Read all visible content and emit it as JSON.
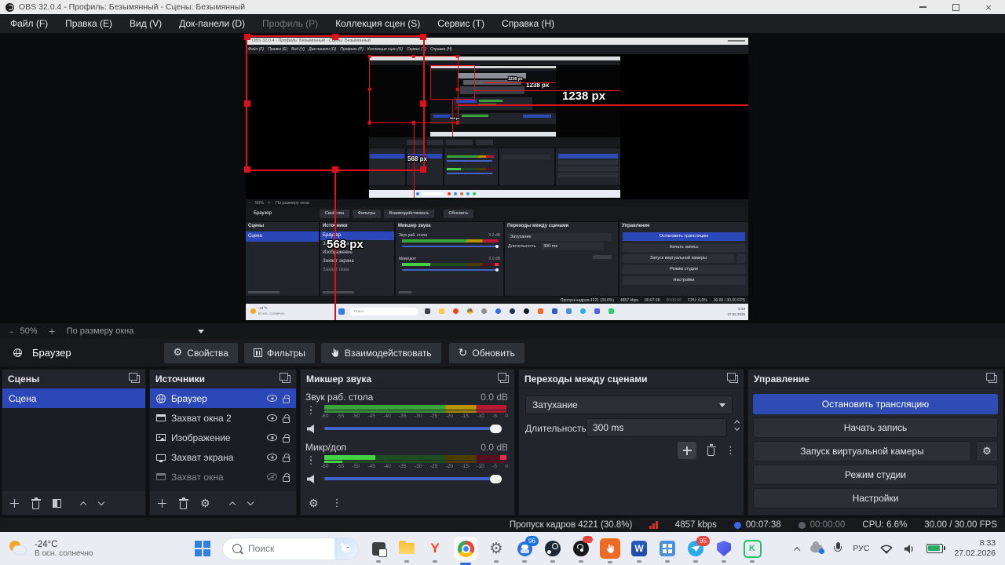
{
  "window": {
    "title": "OBS 32.0.4 - Профиль: Безымянный - Сцены: Безымянный"
  },
  "menu": {
    "items": [
      "Файл (F)",
      "Правка (E)",
      "Вид (V)",
      "Док-панели (D)",
      "Профиль (P)",
      "Коллекция сцен (S)",
      "Сервис (T)",
      "Справка (H)"
    ]
  },
  "preview": {
    "zoom": "50%",
    "fit": "По размеру окна",
    "overlay": {
      "width_label": "1238 px",
      "height_label": "568 px"
    }
  },
  "source_toolbar": {
    "source": "Браузер",
    "properties": "Свойства",
    "filters": "Фильтры",
    "interact": "Взаимодействовать",
    "refresh": "Обновить"
  },
  "scenes": {
    "title": "Сцены",
    "items": [
      "Сцена"
    ]
  },
  "sources": {
    "title": "Источники",
    "items": [
      {
        "label": "Браузер",
        "icon": "globe"
      },
      {
        "label": "Захват окна 2",
        "icon": "window"
      },
      {
        "label": "Изображение",
        "icon": "image"
      },
      {
        "label": "Захват экрана",
        "icon": "display"
      },
      {
        "label": "Захват окна",
        "icon": "window"
      }
    ]
  },
  "mixer": {
    "title": "Микшер звука",
    "channels": [
      {
        "name": "Звук раб. стола",
        "level": "0.0 dB"
      },
      {
        "name": "Микр/доп",
        "level": "0.0 dB"
      }
    ],
    "scale": [
      "-60",
      "-55",
      "-50",
      "-45",
      "-40",
      "-35",
      "-30",
      "-25",
      "-20",
      "-15",
      "-10",
      "-5",
      "0"
    ]
  },
  "transitions": {
    "title": "Переходы между сценами",
    "current": "Затухание",
    "duration_label": "Длительность",
    "duration": "300 ms"
  },
  "controls": {
    "title": "Управление",
    "stop_stream": "Остановить трансляцию",
    "start_record": "Начать запись",
    "virtual_cam": "Запуск виртуальной камеры",
    "studio_mode": "Режим студии",
    "settings": "Настройки"
  },
  "status": {
    "dropped": "Пропуск кадров 4221 (30.8%)",
    "bitrate": "4857 kbps",
    "stream_time": "00:07:38",
    "record_time": "00:00:00",
    "cpu": "CPU: 6.6%",
    "fps": "30.00 / 30.00 FPS"
  },
  "taskbar": {
    "temp": "-24°C",
    "weather": "В осн. солнечно",
    "search": "Поиск",
    "badge_chat": "96",
    "badge_telegram": "95",
    "lang": "РУС",
    "time": "8:33",
    "date": "27.02.2026"
  },
  "icons": {
    "gear": "⚙",
    "dots": "⋮",
    "refresh": "↻",
    "close": "×",
    "minus": "–",
    "plus": "+",
    "word": "W",
    "yandex": "Y",
    "kaspersky": "K"
  },
  "colors": {
    "accent_blue": "#2c47b8",
    "selection_red": "#e01016",
    "meter_green": "#3aa33a",
    "meter_yellow": "#b89300",
    "meter_red": "#bb1833",
    "taskbar_bg": "#e9edf3",
    "panel_bg": "#22252b"
  }
}
